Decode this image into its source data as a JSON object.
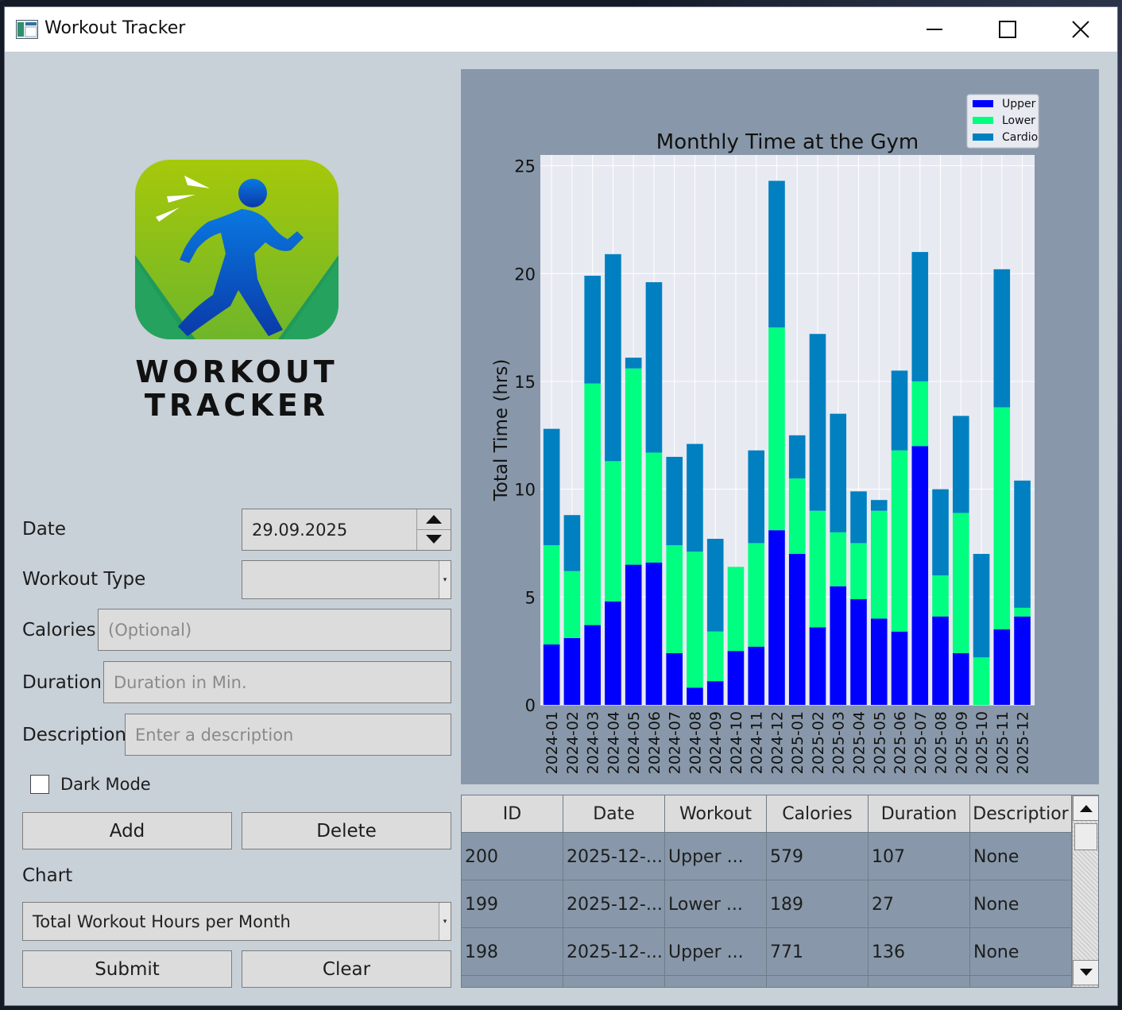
{
  "window": {
    "title": "Workout Tracker"
  },
  "logo": {
    "line1": "WORKOUT",
    "line2": "TRACKER"
  },
  "form": {
    "date_label": "Date",
    "date_value": "29.09.2025",
    "workout_type_label": "Workout Type",
    "workout_type_value": "",
    "calories_label": "Calories",
    "calories_placeholder": "(Optional)",
    "duration_label": "Duration",
    "duration_placeholder": "Duration in Min.",
    "description_label": "Description",
    "description_placeholder": "Enter a description",
    "dark_mode_label": "Dark Mode",
    "dark_mode_checked": false,
    "add_label": "Add",
    "delete_label": "Delete",
    "chart_label": "Chart",
    "chart_value": "Total Workout Hours per Month",
    "submit_label": "Submit",
    "clear_label": "Clear"
  },
  "colors": {
    "upper": "#0000ff",
    "lower": "#00ff80",
    "cardio": "#0080c0",
    "plot_bg": "#e8eaf2",
    "panel_bg": "#8898aa"
  },
  "chart_data": {
    "type": "bar",
    "stacked": true,
    "title": "Monthly Time at the Gym",
    "xlabel": "",
    "ylabel": "Total Time (hrs)",
    "ylim": [
      0,
      25.5
    ],
    "yticks": [
      0,
      5,
      10,
      15,
      20,
      25
    ],
    "grid": true,
    "legend": "top-right",
    "categories": [
      "2024-01",
      "2024-02",
      "2024-03",
      "2024-04",
      "2024-05",
      "2024-06",
      "2024-07",
      "2024-08",
      "2024-09",
      "2024-10",
      "2024-11",
      "2024-12",
      "2025-01",
      "2025-02",
      "2025-03",
      "2025-04",
      "2025-05",
      "2025-06",
      "2025-07",
      "2025-08",
      "2025-09",
      "2025-10",
      "2025-11",
      "2025-12"
    ],
    "series": [
      {
        "name": "Upper",
        "values": [
          2.8,
          3.1,
          3.7,
          4.8,
          6.5,
          6.6,
          2.4,
          0.8,
          1.1,
          2.5,
          2.7,
          8.1,
          7.0,
          3.6,
          5.5,
          4.9,
          4.0,
          3.4,
          12.0,
          4.1,
          2.4,
          0.0,
          3.5,
          4.1
        ]
      },
      {
        "name": "Lower",
        "values": [
          4.6,
          3.1,
          11.2,
          6.5,
          9.1,
          5.1,
          5.0,
          6.3,
          2.3,
          3.9,
          4.8,
          9.4,
          3.5,
          5.4,
          2.5,
          2.6,
          5.0,
          8.4,
          3.0,
          1.9,
          6.5,
          2.2,
          10.3,
          0.4
        ]
      },
      {
        "name": "Cardio",
        "values": [
          5.4,
          2.6,
          5.0,
          9.6,
          0.5,
          7.9,
          4.1,
          5.0,
          4.3,
          0.0,
          4.3,
          6.8,
          2.0,
          8.2,
          5.5,
          2.4,
          0.5,
          3.7,
          6.0,
          4.0,
          4.5,
          4.8,
          6.4,
          5.9
        ]
      }
    ]
  },
  "table": {
    "headers": [
      "ID",
      "Date",
      "Workout",
      "Calories",
      "Duration",
      "Descriptior"
    ],
    "rows": [
      [
        "200",
        "2025-12-...",
        "Upper ...",
        "579",
        "107",
        "None"
      ],
      [
        "199",
        "2025-12-...",
        "Lower ...",
        "189",
        "27",
        "None"
      ],
      [
        "198",
        "2025-12-...",
        "Upper ...",
        "771",
        "136",
        "None"
      ]
    ]
  }
}
